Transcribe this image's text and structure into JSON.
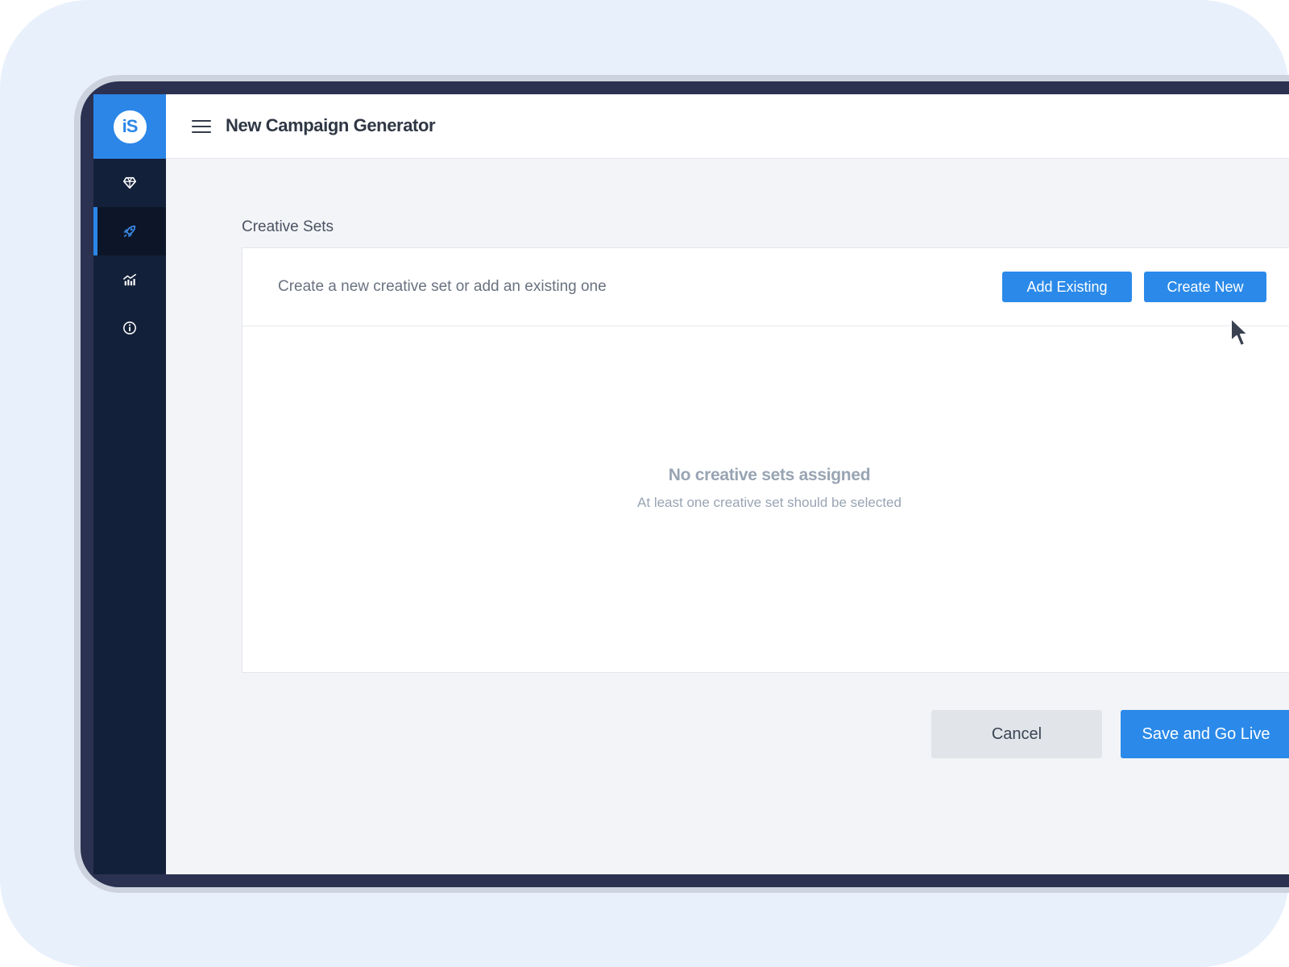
{
  "sidebar": {
    "brand_text": "iS",
    "items": [
      {
        "icon": "diamond-icon",
        "active": false
      },
      {
        "icon": "rocket-icon",
        "active": true
      },
      {
        "icon": "chart-icon",
        "active": false
      },
      {
        "icon": "info-icon",
        "active": false
      }
    ]
  },
  "header": {
    "title": "New Campaign Generator"
  },
  "creative_sets": {
    "label": "Creative Sets",
    "hint": "Create a new creative set or add an existing one",
    "add_existing_label": "Add Existing",
    "create_new_label": "Create New",
    "empty_title": "No creative sets assigned",
    "empty_subtitle": "At least one creative set should be selected"
  },
  "footer": {
    "cancel_label": "Cancel",
    "save_label": "Save and Go Live"
  },
  "colors": {
    "accent": "#2b8ae9",
    "sidebar": "#132039",
    "canvas": "#e8f0fc"
  }
}
